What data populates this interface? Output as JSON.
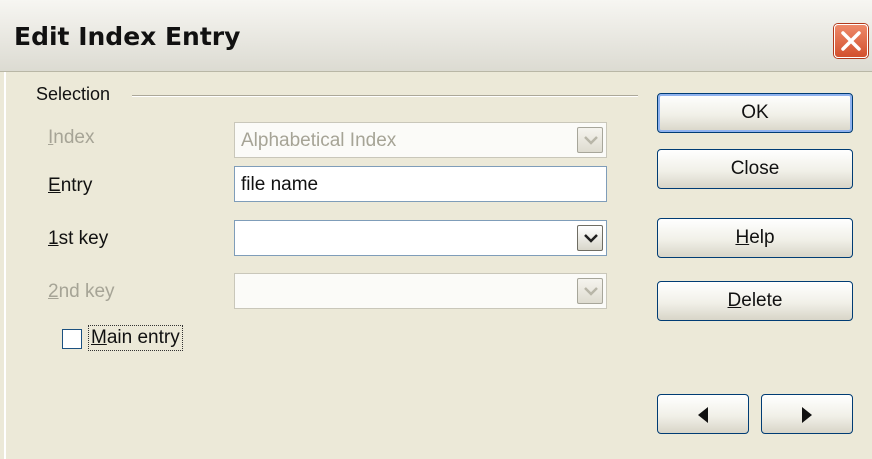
{
  "window": {
    "title": "Edit Index Entry",
    "close_icon": "close-x-icon"
  },
  "selection": {
    "group_label": "Selection",
    "index": {
      "label": "Index",
      "value": "Alphabetical Index",
      "enabled": false
    },
    "entry": {
      "label": "Entry",
      "value": "file name",
      "enabled": true
    },
    "key1": {
      "label": "1st key",
      "value": "",
      "enabled": true
    },
    "key2": {
      "label": "2nd key",
      "value": "",
      "enabled": false
    },
    "main_entry": {
      "label": "Main entry",
      "checked": false
    }
  },
  "buttons": {
    "ok": "OK",
    "close": "Close",
    "help": "Help",
    "delete": "Delete",
    "prev_icon": "arrow-left-icon",
    "next_icon": "arrow-right-icon"
  },
  "colors": {
    "titlebar_bg": "#e6e4da",
    "dialog_bg": "#ece9d8",
    "close_button": "#d9603c",
    "disabled_text": "#a6a496",
    "button_border": "#003c74"
  }
}
